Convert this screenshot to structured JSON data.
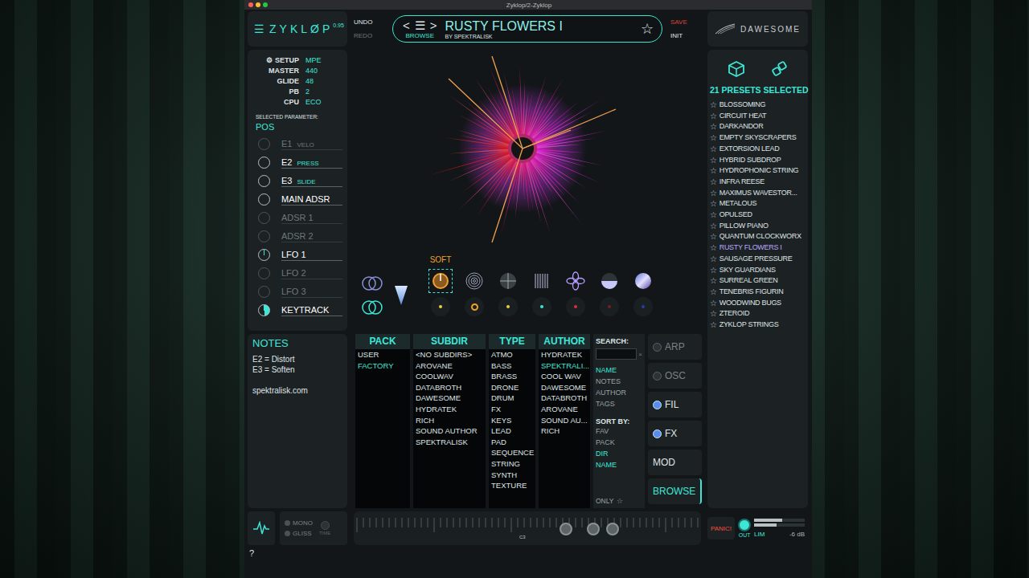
{
  "window": {
    "title": "Zyklop/2-Zyklop"
  },
  "logo": {
    "menu": "☰",
    "name": "ZYKLØP",
    "version": "0.95"
  },
  "history": [
    {
      "label": "UNDO",
      "disabled": false
    },
    {
      "label": "REDO",
      "disabled": true
    }
  ],
  "preset": {
    "prev": "<",
    "menu": "☰",
    "next": ">",
    "name": "RUSTY FLOWERS I",
    "browse": "BROWSE",
    "author": "BY SPEKTRALISK",
    "star": "☆",
    "favorite": false
  },
  "presetActions": [
    {
      "label": "SAVE",
      "color": "#d8443c"
    },
    {
      "label": "INIT",
      "color": "#e4e8ea"
    }
  ],
  "brand": "DAWESOME",
  "setup": {
    "icon": "⚙",
    "label": "SETUP",
    "mode": "MPE",
    "rows": [
      {
        "label": "MASTER",
        "value": "440"
      },
      {
        "label": "GLIDE",
        "value": "48"
      },
      {
        "label": "PB",
        "value": "2"
      },
      {
        "label": "CPU",
        "value": "ECO"
      }
    ]
  },
  "selectedParameter": {
    "label": "SELECTED PARAMETER:",
    "value": "POS"
  },
  "modSources": [
    {
      "label": "E1",
      "sub": "VELO",
      "active": false,
      "level": 0
    },
    {
      "label": "E2",
      "sub": "PRESS",
      "active": true,
      "level": 0
    },
    {
      "label": "E3",
      "sub": "SLIDE",
      "active": true,
      "level": 0
    },
    {
      "label": "MAIN ADSR",
      "sub": "",
      "active": true,
      "level": 0
    },
    {
      "label": "ADSR 1",
      "sub": "",
      "active": false,
      "level": 0
    },
    {
      "label": "ADSR 2",
      "sub": "",
      "active": false,
      "level": 0
    },
    {
      "label": "LFO 1",
      "sub": "",
      "active": true,
      "level": 0.02
    },
    {
      "label": "LFO 2",
      "sub": "",
      "active": false,
      "level": 0
    },
    {
      "label": "LFO 3",
      "sub": "",
      "active": false,
      "level": 0
    },
    {
      "label": "KEYTRACK",
      "sub": "",
      "active": true,
      "level": 0.5
    }
  ],
  "routing": [
    {
      "kind": "rings",
      "selected": false
    },
    {
      "kind": "rings",
      "selected": true
    }
  ],
  "effects": [
    {
      "kind": "knob",
      "label": "SOFT",
      "selected": true,
      "dot": "#e8d040",
      "ring": false
    },
    {
      "kind": "spiral",
      "selected": false,
      "dot": "#f0a030",
      "ring": true
    },
    {
      "kind": "cross",
      "selected": false,
      "dot": "#e8d040",
      "ring": false
    },
    {
      "kind": "bars",
      "selected": false,
      "dot": "#3ee6d6",
      "ring": false
    },
    {
      "kind": "fan",
      "selected": false,
      "dot": "#d8303c",
      "ring": false
    },
    {
      "kind": "half",
      "selected": false,
      "dot": "#7a1c24",
      "ring": false
    },
    {
      "kind": "sphere",
      "selected": false,
      "dot": "#2c3a9c",
      "ring": false
    }
  ],
  "notes": {
    "title": "NOTES",
    "lines": [
      "E2 = Distort",
      "E3 = Soften"
    ],
    "link": "spektralisk.com"
  },
  "browser": {
    "columns": [
      {
        "title": "PACK",
        "items": [
          {
            "label": "USER",
            "selected": false
          },
          {
            "label": "FACTORY",
            "selected": true
          }
        ]
      },
      {
        "title": "SUBDIR",
        "items": [
          {
            "label": "<NO SUBDIRS>",
            "selected": false
          },
          {
            "label": "AROVANE",
            "selected": false
          },
          {
            "label": "COOLWAV",
            "selected": false
          },
          {
            "label": "DATABROTH",
            "selected": false
          },
          {
            "label": "DAWESOME",
            "selected": false
          },
          {
            "label": "HYDRATEK",
            "selected": false
          },
          {
            "label": "RICH",
            "selected": false
          },
          {
            "label": "SOUND AUTHOR",
            "selected": false
          },
          {
            "label": "SPEKTRALISK",
            "selected": false
          }
        ]
      },
      {
        "title": "TYPE",
        "items": [
          {
            "label": "ATMO",
            "selected": false
          },
          {
            "label": "BASS",
            "selected": false
          },
          {
            "label": "BRASS",
            "selected": false
          },
          {
            "label": "DRONE",
            "selected": false
          },
          {
            "label": "DRUM",
            "selected": false
          },
          {
            "label": "FX",
            "selected": false
          },
          {
            "label": "KEYS",
            "selected": false
          },
          {
            "label": "LEAD",
            "selected": false
          },
          {
            "label": "PAD",
            "selected": false
          },
          {
            "label": "SEQUENCE",
            "selected": false
          },
          {
            "label": "STRING",
            "selected": false
          },
          {
            "label": "SYNTH",
            "selected": false
          },
          {
            "label": "TEXTURE",
            "selected": false
          }
        ]
      },
      {
        "title": "AUTHOR",
        "items": [
          {
            "label": "HYDRATEK",
            "selected": false
          },
          {
            "label": "SPEKTRALI...",
            "selected": true
          },
          {
            "label": "COOL WAV",
            "selected": false
          },
          {
            "label": "DAWESOME",
            "selected": false
          },
          {
            "label": "DATABROTH",
            "selected": false
          },
          {
            "label": "AROVANE",
            "selected": false
          },
          {
            "label": "SOUND AU...",
            "selected": false
          },
          {
            "label": "RICH",
            "selected": false
          }
        ]
      }
    ],
    "search": {
      "label": "SEARCH:",
      "value": "",
      "clear": "×",
      "fields": [
        {
          "label": "NAME",
          "selected": true
        },
        {
          "label": "NOTES",
          "selected": false
        },
        {
          "label": "AUTHOR",
          "selected": false
        },
        {
          "label": "TAGS",
          "selected": false
        }
      ],
      "sortLabel": "SORT BY:",
      "sort": [
        {
          "label": "FAV",
          "selected": false
        },
        {
          "label": "PACK",
          "selected": false
        },
        {
          "label": "DIR",
          "selected": true
        },
        {
          "label": "NAME",
          "selected": true
        }
      ],
      "only": {
        "label": "ONLY",
        "star": "☆",
        "checked": false
      }
    }
  },
  "sections": [
    {
      "label": "ARP",
      "kind": "toggle",
      "on": false,
      "selected": false
    },
    {
      "label": "OSC",
      "kind": "toggle",
      "on": false,
      "selected": false
    },
    {
      "label": "FIL",
      "kind": "toggle",
      "on": true,
      "selected": false
    },
    {
      "label": "FX",
      "kind": "toggle",
      "on": true,
      "selected": false
    },
    {
      "label": "MOD",
      "kind": "button",
      "on": false,
      "selected": false
    },
    {
      "label": "BROWSE",
      "kind": "button",
      "on": false,
      "selected": true
    }
  ],
  "presetList": {
    "count": "21 PRESETS SELECTED",
    "star": "☆",
    "items": [
      {
        "name": "BLOSSOMING",
        "selected": false,
        "favorite": false
      },
      {
        "name": "CIRCUIT HEAT",
        "selected": false,
        "favorite": false
      },
      {
        "name": "DARKANDOR",
        "selected": false,
        "favorite": false
      },
      {
        "name": "EMPTY SKYSCRAPERS",
        "selected": false,
        "favorite": false
      },
      {
        "name": "EXTORSION LEAD",
        "selected": false,
        "favorite": false
      },
      {
        "name": "HYBRID SUBDROP",
        "selected": false,
        "favorite": false
      },
      {
        "name": "HYDROPHONIC STRING",
        "selected": false,
        "favorite": false
      },
      {
        "name": "INFRA REESE",
        "selected": false,
        "favorite": false
      },
      {
        "name": "MAXIMUS WAVESTOR...",
        "selected": false,
        "favorite": false
      },
      {
        "name": "METALOUS",
        "selected": false,
        "favorite": false
      },
      {
        "name": "OPULSED",
        "selected": false,
        "favorite": false
      },
      {
        "name": "PILLOW PIANO",
        "selected": false,
        "favorite": false
      },
      {
        "name": "QUANTUM CLOCKWORX",
        "selected": false,
        "favorite": false
      },
      {
        "name": "RUSTY FLOWERS I",
        "selected": true,
        "favorite": false
      },
      {
        "name": "SAUSAGE PRESSURE",
        "selected": false,
        "favorite": false
      },
      {
        "name": "SKY GUARDIANS",
        "selected": false,
        "favorite": false
      },
      {
        "name": "SURREAL GREEN",
        "selected": false,
        "favorite": false
      },
      {
        "name": "TENEBRIS FIGURIN",
        "selected": false,
        "favorite": false
      },
      {
        "name": "WOODWIND BUGS",
        "selected": false,
        "favorite": false
      },
      {
        "name": "ZTEROID",
        "selected": false,
        "favorite": false
      },
      {
        "name": "ZYKLOP STRINGS",
        "selected": false,
        "favorite": false
      }
    ]
  },
  "voice": {
    "mono": {
      "label": "MONO",
      "on": false
    },
    "gliss": {
      "label": "GLISS",
      "on": false
    },
    "time": "TIME"
  },
  "keyboard": {
    "marker": "C3",
    "handles": [
      {
        "level": 0.61
      },
      {
        "level": 0.69
      },
      {
        "level": 0.745
      }
    ]
  },
  "output": {
    "panic": "PANIC!",
    "out": "OUT",
    "lim": "LIM",
    "reading": "-6 dB",
    "levels": [
      0.55,
      0.45
    ]
  },
  "help": "?"
}
